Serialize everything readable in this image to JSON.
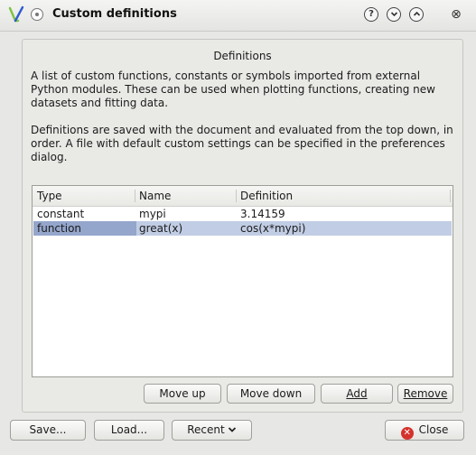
{
  "window": {
    "title": "Custom definitions",
    "help_glyph": "?",
    "minimize_glyph": "⌄",
    "maximize_glyph": "⌃",
    "close_glyph": "⊗"
  },
  "group": {
    "title": "Definitions",
    "para1_line1": "A list of custom functions, constants or symbols imported from external",
    "para1_line2": "Python modules. These can be used when plotting functions, creating new",
    "para1_line3": "datasets and fitting data.",
    "para2_line1": "Definitions are saved with the document and  evaluated from the top down, in",
    "para2_line2": "order. A file with default custom settings can be specified in the preferences",
    "para2_line3": "dialog."
  },
  "table": {
    "headers": [
      "Type",
      "Name",
      "Definition"
    ],
    "rows": [
      {
        "type": "constant",
        "name": "mypi",
        "definition": "3.14159"
      },
      {
        "type": "function",
        "name": "great(x)",
        "definition": "cos(x*mypi)"
      }
    ]
  },
  "buttons": {
    "move_up": "Move up",
    "move_down": "Move down",
    "add": "Add",
    "remove": "Remove",
    "save": "Save...",
    "load": "Load...",
    "recent": "Recent",
    "close": "Close"
  },
  "colors": {
    "selection": "#c1cde4",
    "selection_focus": "#95a6cc",
    "logo_v_green": "#7cc444",
    "logo_v_blue": "#2f5bd3",
    "close_red": "#d4322d"
  },
  "icons": {
    "logo": "veusz-logo-icon",
    "recent_chevron": "chevron-down-icon",
    "close": "close-circle-icon"
  }
}
